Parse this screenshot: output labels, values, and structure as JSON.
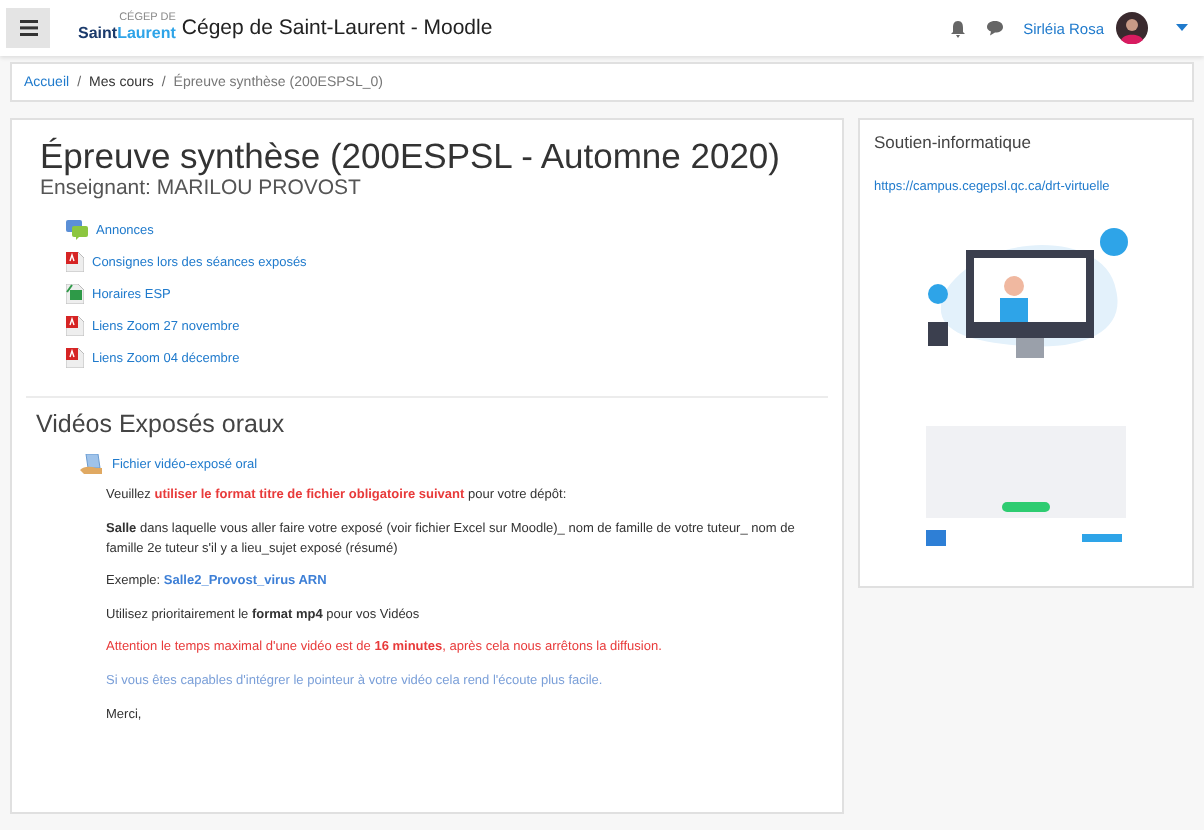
{
  "navbar": {
    "logo": {
      "small": "CÉGEP DE",
      "part1": "Saint",
      "part2": "Laurent"
    },
    "site_name": "Cégep de Saint-Laurent - Moodle",
    "user_name": "Sirléia Rosa"
  },
  "breadcrumb": {
    "separator": "/",
    "items": [
      {
        "label": "Accueil",
        "kind": "link"
      },
      {
        "label": "Mes cours",
        "kind": "plain"
      },
      {
        "label": "Épreuve synthèse (200ESPSL_0)",
        "kind": "current"
      }
    ]
  },
  "course": {
    "title": "Épreuve synthèse (200ESPSL - Automne 2020)",
    "teacher": "Enseignant: MARILOU PROVOST",
    "activities": [
      {
        "label": "Annonces",
        "kind": "forum"
      },
      {
        "label": "Consignes lors des séances exposés",
        "kind": "pdf"
      },
      {
        "label": "Horaires ESP",
        "kind": "spreadsheet"
      },
      {
        "label": "Liens Zoom 27 novembre",
        "kind": "pdf"
      },
      {
        "label": "Liens Zoom 04 décembre",
        "kind": "pdf"
      }
    ]
  },
  "section": {
    "title": "Vidéos Exposés oraux",
    "file": {
      "label": "Fichier vidéo-exposé oral",
      "kind": "assignment"
    },
    "paragraphs": [
      {
        "kind": "plain",
        "segments": [
          {
            "text": "Veuillez ",
            "kind": "plain"
          },
          {
            "text": "utiliser le format titre de fichier obligatoire suivant",
            "kind": "emphasis"
          },
          {
            "text": " pour votre dépôt:",
            "kind": "plain"
          }
        ]
      },
      {
        "kind": "plain",
        "segments": [
          {
            "text": "Salle",
            "kind": "bold"
          },
          {
            "text": " dans laquelle vous aller faire votre exposé (voir fichier Excel sur Moodle)_ nom de famille de votre tuteur_ nom de famille 2e tuteur s'il y a lieu_sujet exposé (résumé)",
            "kind": "plain"
          }
        ]
      },
      {
        "kind": "plain",
        "segments": [
          {
            "text": "Exemple: ",
            "kind": "plain"
          },
          {
            "text": "Salle2_Provost_virus ARN",
            "kind": "example"
          }
        ]
      },
      {
        "kind": "plain",
        "segments": [
          {
            "text": "Utilisez prioritairement le ",
            "kind": "plain"
          },
          {
            "text": "format mp4",
            "kind": "bold"
          },
          {
            "text": " pour vos Vidéos",
            "kind": "plain"
          }
        ]
      },
      {
        "kind": "warning",
        "segments": [
          {
            "text": "Attention le temps maximal d'une vidéo est de ",
            "kind": "plain"
          },
          {
            "text": "16 minutes",
            "kind": "bold"
          },
          {
            "text": ", après cela nous arrêtons la diffusion.",
            "kind": "plain"
          }
        ]
      },
      {
        "kind": "note",
        "segments": [
          {
            "text": "Si vous êtes capables d'intégrer le pointeur à votre vidéo cela rend l'écoute plus facile.",
            "kind": "plain"
          }
        ]
      },
      {
        "kind": "plain",
        "segments": [
          {
            "text": "Merci,",
            "kind": "plain"
          }
        ]
      }
    ]
  },
  "sidebar": {
    "title": "Soutien-informatique",
    "link": "https://campus.cegepsl.qc.ca/drt-virtuelle"
  }
}
